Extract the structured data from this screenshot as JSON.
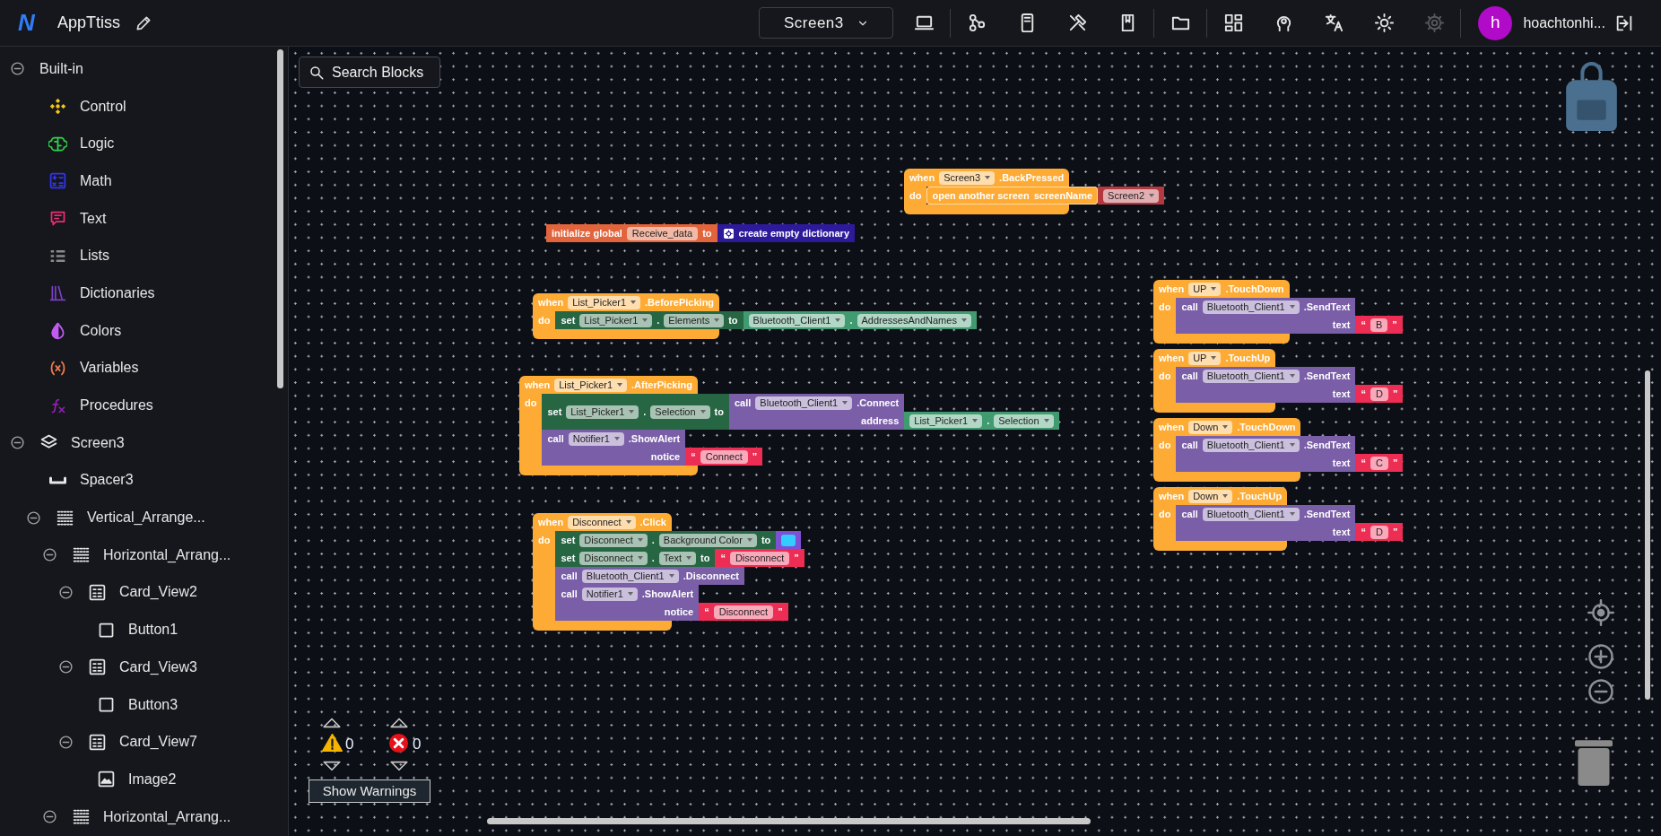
{
  "app": {
    "logo": "N",
    "project_name": "AppTtiss"
  },
  "screen_selector": {
    "value": "Screen3"
  },
  "toolbar_groups": [
    [
      {
        "kind": "laptop",
        "disabled": false
      }
    ],
    [
      {
        "kind": "graph",
        "disabled": false
      },
      {
        "kind": "phone",
        "disabled": false
      },
      {
        "kind": "tools",
        "disabled": false
      },
      {
        "kind": "book",
        "disabled": false
      }
    ],
    [
      {
        "kind": "folder",
        "disabled": false
      }
    ],
    [
      {
        "kind": "dashboard",
        "disabled": false
      },
      {
        "kind": "head",
        "disabled": false
      },
      {
        "kind": "translate",
        "disabled": false
      },
      {
        "kind": "sun",
        "disabled": false
      },
      {
        "kind": "gear",
        "disabled": true
      }
    ]
  ],
  "user": {
    "initial": "h",
    "name": "hoachtonhi..."
  },
  "sidebar": {
    "tree": [
      {
        "label": "Built-in",
        "kind": "builtin",
        "expanded": true,
        "children": [
          {
            "label": "Control",
            "kind": "control"
          },
          {
            "label": "Logic",
            "kind": "logic"
          },
          {
            "label": "Math",
            "kind": "math"
          },
          {
            "label": "Text",
            "kind": "text"
          },
          {
            "label": "Lists",
            "kind": "lists"
          },
          {
            "label": "Dictionaries",
            "kind": "dictionaries"
          },
          {
            "label": "Colors",
            "kind": "colors"
          },
          {
            "label": "Variables",
            "kind": "variables"
          },
          {
            "label": "Procedures",
            "kind": "procedures"
          }
        ]
      },
      {
        "label": "Screen3",
        "kind": "screen",
        "expanded": true,
        "children": [
          {
            "label": "Spacer3",
            "kind": "spacer"
          },
          {
            "label": "Vertical_Arrange...",
            "kind": "arrangement",
            "expanded": true,
            "children": [
              {
                "label": "Horizontal_Arrang...",
                "kind": "arrangement",
                "expanded": true,
                "children": [
                  {
                    "label": "Card_View2",
                    "kind": "card_view",
                    "expanded": true,
                    "children": [
                      {
                        "label": "Button1",
                        "kind": "button"
                      }
                    ]
                  },
                  {
                    "label": "Card_View3",
                    "kind": "card_view",
                    "expanded": true,
                    "children": [
                      {
                        "label": "Button3",
                        "kind": "button"
                      }
                    ]
                  },
                  {
                    "label": "Card_View7",
                    "kind": "card_view",
                    "expanded": true,
                    "children": [
                      {
                        "label": "Image2",
                        "kind": "image"
                      }
                    ]
                  }
                ]
              },
              {
                "label": "Horizontal_Arrang...",
                "kind": "arrangement",
                "expanded": true
              }
            ]
          }
        ]
      }
    ]
  },
  "workspace": {
    "search_button": "Search Blocks",
    "blocks": [
      {
        "kind": "event",
        "rows": [
          {
            "tokens": [
              {
                "label": "when"
              },
              {
                "dropdown": "Screen3"
              },
              {
                "label": ".BackPressed"
              }
            ]
          }
        ],
        "statement_label": "do",
        "body": [
          {
            "kind": "open_screen",
            "rows": [
              {
                "tokens": [
                  {
                    "label": "open another screen"
                  },
                  {
                    "label": "screenName"
                  }
                ],
                "value": {
                  "kind": "screen_name",
                  "rows": [
                    {
                      "tokens": [
                        {
                          "dropdown": "Screen2"
                        }
                      ]
                    }
                  ]
                }
              }
            ]
          }
        ]
      },
      {
        "kind": "global_declaration",
        "rows": [
          {
            "tokens": [
              {
                "label": "initialize global"
              },
              {
                "field": "Receive_data"
              },
              {
                "label": "to"
              }
            ],
            "value": {
              "kind": "dictionary",
              "rows": [
                {
                  "tokens": [
                    {
                      "label": "create empty dictionary"
                    }
                  ]
                }
              ]
            }
          }
        ]
      },
      {
        "kind": "event",
        "rows": [
          {
            "tokens": [
              {
                "label": "when"
              },
              {
                "dropdown": "List_Picker1"
              },
              {
                "label": ".BeforePicking"
              }
            ]
          }
        ],
        "statement_label": "do",
        "body": [
          {
            "kind": "setter",
            "rows": [
              {
                "tokens": [
                  {
                    "label": "set"
                  },
                  {
                    "dropdown": "List_Picker1"
                  },
                  {
                    "label": "."
                  },
                  {
                    "dropdown": "Elements"
                  },
                  {
                    "label": "to"
                  }
                ],
                "value": {
                  "kind": "getter",
                  "rows": [
                    {
                      "tokens": [
                        {
                          "dropdown": "Bluetooth_Client1"
                        },
                        {
                          "label": "."
                        },
                        {
                          "dropdown": "AddressesAndNames"
                        }
                      ]
                    }
                  ]
                }
              }
            ]
          }
        ]
      },
      {
        "kind": "event",
        "rows": [
          {
            "tokens": [
              {
                "label": "when"
              },
              {
                "dropdown": "List_Picker1"
              },
              {
                "label": ".AfterPicking"
              }
            ]
          }
        ],
        "statement_label": "do",
        "body": [
          {
            "kind": "setter",
            "rows": [
              {
                "tokens": [
                  {
                    "label": "set"
                  },
                  {
                    "dropdown": "List_Picker1"
                  },
                  {
                    "label": "."
                  },
                  {
                    "dropdown": "Selection"
                  },
                  {
                    "label": "to"
                  }
                ],
                "value": {
                  "kind": "method",
                  "rows": [
                    {
                      "tokens": [
                        {
                          "label": "call"
                        },
                        {
                          "dropdown": "Bluetooth_Client1"
                        },
                        {
                          "label": ".Connect"
                        }
                      ]
                    },
                    {
                      "tokens": [
                        {
                          "label": "address"
                        }
                      ],
                      "value": {
                        "kind": "getter",
                        "rows": [
                          {
                            "tokens": [
                              {
                                "dropdown": "List_Picker1"
                              },
                              {
                                "label": "."
                              },
                              {
                                "dropdown": "Selection"
                              }
                            ]
                          }
                        ]
                      }
                    }
                  ]
                }
              }
            ]
          },
          {
            "kind": "method",
            "rows": [
              {
                "tokens": [
                  {
                    "label": "call"
                  },
                  {
                    "dropdown": "Notifier1"
                  },
                  {
                    "label": ".ShowAlert"
                  }
                ]
              },
              {
                "tokens": [
                  {
                    "label": "notice"
                  }
                ],
                "value": {
                  "kind": "text",
                  "rows": [
                    {
                      "tokens": [
                        {
                          "label": "“"
                        },
                        {
                          "field": "Connect"
                        },
                        {
                          "label": "”"
                        }
                      ]
                    }
                  ]
                }
              }
            ]
          }
        ]
      },
      {
        "kind": "event",
        "rows": [
          {
            "tokens": [
              {
                "label": "when"
              },
              {
                "dropdown": "Disconnect"
              },
              {
                "label": ".Click"
              }
            ]
          }
        ],
        "statement_label": "do",
        "body": [
          {
            "kind": "setter",
            "rows": [
              {
                "tokens": [
                  {
                    "label": "set"
                  },
                  {
                    "dropdown": "Disconnect"
                  },
                  {
                    "label": "."
                  },
                  {
                    "dropdown": "Background Color"
                  },
                  {
                    "label": "to"
                  }
                ],
                "value": {
                  "kind": "color",
                  "color": "#33ccff"
                }
              }
            ]
          },
          {
            "kind": "setter",
            "rows": [
              {
                "tokens": [
                  {
                    "label": "set"
                  },
                  {
                    "dropdown": "Disconnect"
                  },
                  {
                    "label": "."
                  },
                  {
                    "dropdown": "Text"
                  },
                  {
                    "label": "to"
                  }
                ],
                "value": {
                  "kind": "text",
                  "rows": [
                    {
                      "tokens": [
                        {
                          "label": "“"
                        },
                        {
                          "field": "Disconnect"
                        },
                        {
                          "label": "”"
                        }
                      ]
                    }
                  ]
                }
              }
            ]
          },
          {
            "kind": "method",
            "rows": [
              {
                "tokens": [
                  {
                    "label": "call"
                  },
                  {
                    "dropdown": "Bluetooth_Client1"
                  },
                  {
                    "label": ".Disconnect"
                  }
                ]
              }
            ]
          },
          {
            "kind": "method",
            "rows": [
              {
                "tokens": [
                  {
                    "label": "call"
                  },
                  {
                    "dropdown": "Notifier1"
                  },
                  {
                    "label": ".ShowAlert"
                  }
                ]
              },
              {
                "tokens": [
                  {
                    "label": "notice"
                  }
                ],
                "value": {
                  "kind": "text",
                  "rows": [
                    {
                      "tokens": [
                        {
                          "label": "“"
                        },
                        {
                          "field": "Disconnect"
                        },
                        {
                          "label": "”"
                        }
                      ]
                    }
                  ]
                }
              }
            ]
          }
        ]
      },
      {
        "kind": "event",
        "rows": [
          {
            "tokens": [
              {
                "label": "when"
              },
              {
                "dropdown": "UP"
              },
              {
                "label": ".TouchDown"
              }
            ]
          }
        ],
        "statement_label": "do",
        "body": [
          {
            "kind": "method",
            "rows": [
              {
                "tokens": [
                  {
                    "label": "call"
                  },
                  {
                    "dropdown": "Bluetooth_Client1"
                  },
                  {
                    "label": ".SendText"
                  }
                ]
              },
              {
                "tokens": [
                  {
                    "label": "text"
                  }
                ],
                "value": {
                  "kind": "text",
                  "rows": [
                    {
                      "tokens": [
                        {
                          "label": "“"
                        },
                        {
                          "field": "B"
                        },
                        {
                          "label": "”"
                        }
                      ]
                    }
                  ]
                }
              }
            ]
          }
        ]
      },
      {
        "kind": "event",
        "rows": [
          {
            "tokens": [
              {
                "label": "when"
              },
              {
                "dropdown": "UP"
              },
              {
                "label": ".TouchUp"
              }
            ]
          }
        ],
        "statement_label": "do",
        "body": [
          {
            "kind": "method",
            "rows": [
              {
                "tokens": [
                  {
                    "label": "call"
                  },
                  {
                    "dropdown": "Bluetooth_Client1"
                  },
                  {
                    "label": ".SendText"
                  }
                ]
              },
              {
                "tokens": [
                  {
                    "label": "text"
                  }
                ],
                "value": {
                  "kind": "text",
                  "rows": [
                    {
                      "tokens": [
                        {
                          "label": "“"
                        },
                        {
                          "field": "D"
                        },
                        {
                          "label": "”"
                        }
                      ]
                    }
                  ]
                }
              }
            ]
          }
        ]
      },
      {
        "kind": "event",
        "rows": [
          {
            "tokens": [
              {
                "label": "when"
              },
              {
                "dropdown": "Down"
              },
              {
                "label": ".TouchDown"
              }
            ]
          }
        ],
        "statement_label": "do",
        "body": [
          {
            "kind": "method",
            "rows": [
              {
                "tokens": [
                  {
                    "label": "call"
                  },
                  {
                    "dropdown": "Bluetooth_Client1"
                  },
                  {
                    "label": ".SendText"
                  }
                ]
              },
              {
                "tokens": [
                  {
                    "label": "text"
                  }
                ],
                "value": {
                  "kind": "text",
                  "rows": [
                    {
                      "tokens": [
                        {
                          "label": "“"
                        },
                        {
                          "field": "C"
                        },
                        {
                          "label": "”"
                        }
                      ]
                    }
                  ]
                }
              }
            ]
          }
        ]
      },
      {
        "kind": "event",
        "rows": [
          {
            "tokens": [
              {
                "label": "when"
              },
              {
                "dropdown": "Down"
              },
              {
                "label": ".TouchUp"
              }
            ]
          }
        ],
        "statement_label": "do",
        "body": [
          {
            "kind": "method",
            "rows": [
              {
                "tokens": [
                  {
                    "label": "call"
                  },
                  {
                    "dropdown": "Bluetooth_Client1"
                  },
                  {
                    "label": ".SendText"
                  }
                ]
              },
              {
                "tokens": [
                  {
                    "label": "text"
                  }
                ],
                "value": {
                  "kind": "text",
                  "rows": [
                    {
                      "tokens": [
                        {
                          "label": "“"
                        },
                        {
                          "field": "D"
                        },
                        {
                          "label": "”"
                        }
                      ]
                    }
                  ]
                }
              }
            ]
          }
        ]
      }
    ],
    "warnings": {
      "warning_count": "0",
      "error_count": "0",
      "button": "Show Warnings"
    }
  }
}
